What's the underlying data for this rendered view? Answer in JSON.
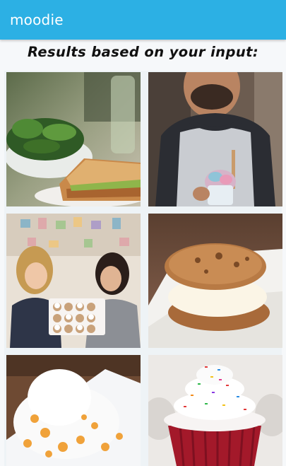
{
  "app_bar": {
    "title": "moodie",
    "color": "#2cb0e4"
  },
  "results": {
    "heading": "Results based on your input:",
    "items": [
      {
        "icon": "salad-sandwich-photo"
      },
      {
        "icon": "man-ice-cream-photo"
      },
      {
        "icon": "women-cupcake-box-photo"
      },
      {
        "icon": "ice-cream-cookie-sandwich-photo"
      },
      {
        "icon": "shaved-ice-mango-photo"
      },
      {
        "icon": "red-velvet-cupcake-photo"
      }
    ]
  }
}
